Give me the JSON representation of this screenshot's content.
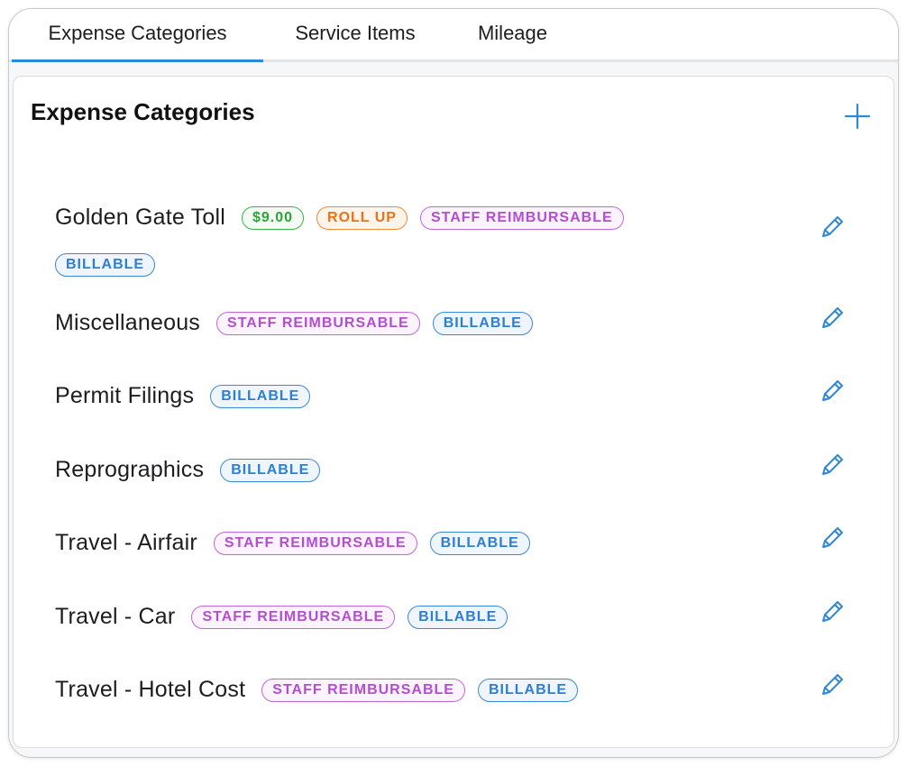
{
  "tabs": [
    {
      "label": "Expense Categories",
      "active": true
    },
    {
      "label": "Service Items",
      "active": false
    },
    {
      "label": "Mileage",
      "active": false
    }
  ],
  "panel": {
    "title": "Expense Categories",
    "add_icon": "plus-icon",
    "edit_icon": "pencil-icon"
  },
  "colors": {
    "accent": "#2f87d8",
    "money": "#2ea43c",
    "roll_up": "#e8731a",
    "staff_reimbursable": "#b34fcf",
    "billable": "#2f7fd0"
  },
  "categories": [
    {
      "name": "Golden Gate Toll",
      "badges": [
        {
          "text": "$9.00",
          "kind": "money"
        },
        {
          "text": "ROLL UP",
          "kind": "rollup"
        },
        {
          "text": "STAFF REIMBURSABLE",
          "kind": "staff"
        },
        {
          "text": "BILLABLE",
          "kind": "billable"
        }
      ]
    },
    {
      "name": "Miscellaneous",
      "badges": [
        {
          "text": "STAFF REIMBURSABLE",
          "kind": "staff"
        },
        {
          "text": "BILLABLE",
          "kind": "billable"
        }
      ]
    },
    {
      "name": "Permit Filings",
      "badges": [
        {
          "text": "BILLABLE",
          "kind": "billable"
        }
      ]
    },
    {
      "name": "Reprographics",
      "badges": [
        {
          "text": "BILLABLE",
          "kind": "billable"
        }
      ]
    },
    {
      "name": "Travel - Airfair",
      "badges": [
        {
          "text": "STAFF REIMBURSABLE",
          "kind": "staff"
        },
        {
          "text": "BILLABLE",
          "kind": "billable"
        }
      ]
    },
    {
      "name": "Travel - Car",
      "badges": [
        {
          "text": "STAFF REIMBURSABLE",
          "kind": "staff"
        },
        {
          "text": "BILLABLE",
          "kind": "billable"
        }
      ]
    },
    {
      "name": "Travel - Hotel Cost",
      "badges": [
        {
          "text": "STAFF REIMBURSABLE",
          "kind": "staff"
        },
        {
          "text": "BILLABLE",
          "kind": "billable"
        }
      ]
    }
  ]
}
